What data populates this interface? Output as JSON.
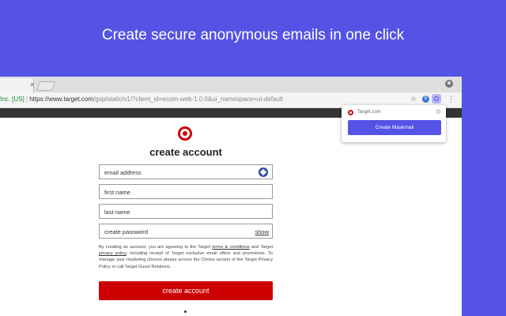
{
  "headline": "Create secure anonymous emails in one click",
  "browser": {
    "tab_close": "×",
    "url": {
      "site": "Inc. [US]",
      "separator": " | ",
      "host": "https://www.target.com",
      "path": "/gsp/static/v1/?client_id=ecom-web-1.0.0&ui_namespace=ui-default"
    },
    "star": "☆",
    "ext1": "6",
    "menu": "⋮"
  },
  "form": {
    "title": "create account",
    "email_label": "email address",
    "first_label": "first name",
    "last_label": "last name",
    "password_label": "create password",
    "show_label": "show",
    "legal_1": "By creating an account, you are agreeing to the Target ",
    "terms_link": "terms & conditions",
    "legal_2": " and Target ",
    "privacy_link": "privacy policy",
    "legal_3": ", including receipt of Target exclusive email offers and promotions. To manage your marketing choices please access the Choice section of the Target Privacy Policy or call Target Guest Relations.",
    "submit_label": "create account"
  },
  "popup": {
    "site": "Target.com",
    "gear": "⚙",
    "button_label": "Create Maskmail"
  },
  "colors": {
    "background": "#5453e6",
    "brand_red": "#cc0000",
    "maskmail_accent": "#5453e6"
  }
}
